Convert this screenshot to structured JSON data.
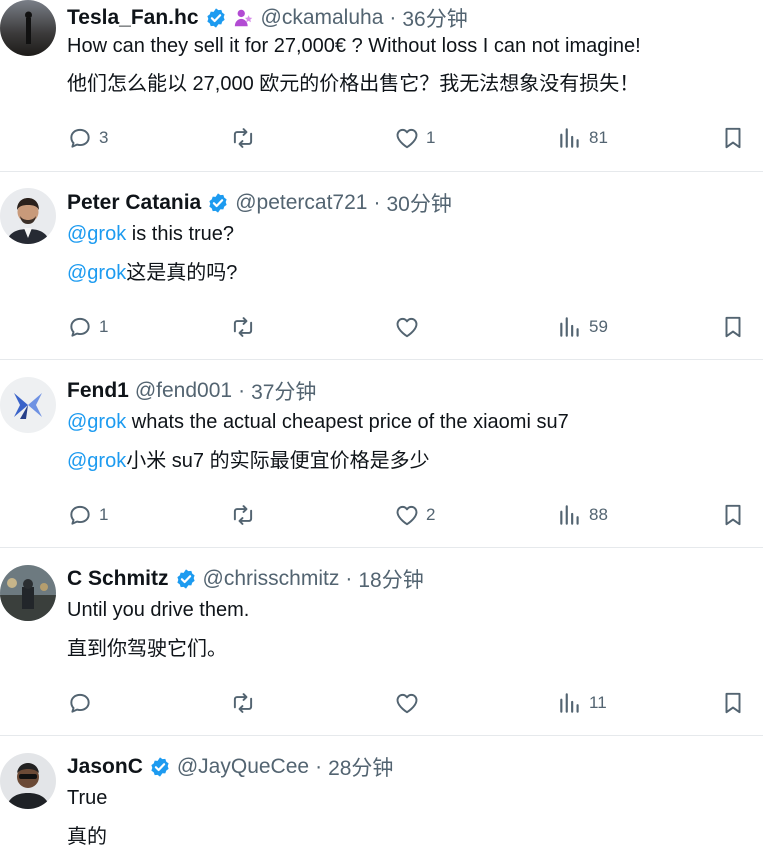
{
  "tweets": [
    {
      "name": "Tesla_Fan.hc",
      "handle": "@ckamaluha",
      "time": "36分钟",
      "text_en": "How can they sell it for 27,000€ ? Without loss I can not imagine!",
      "text_zh": "他们怎么能以 27,000 欧元的价格出售它？我无法想象没有损失！",
      "replies": "3",
      "reposts": "",
      "likes": "1",
      "views": "81"
    },
    {
      "name": "Peter Catania",
      "handle": "@petercat721",
      "time": "30分钟",
      "mention": "@grok",
      "text_en": " is this true?",
      "text_zh": "这是真的吗?",
      "replies": "1",
      "reposts": "",
      "likes": "",
      "views": "59"
    },
    {
      "name": "Fend1",
      "handle": "@fend001",
      "time": "37分钟",
      "mention": "@grok",
      "text_en": " whats the actual cheapest price of the xiaomi su7",
      "text_zh": "小米 su7 的实际最便宜价格是多少",
      "replies": "1",
      "reposts": "",
      "likes": "2",
      "views": "88"
    },
    {
      "name": "C Schmitz",
      "handle": "@chrisschmitz",
      "time": "18分钟",
      "text_en": "Until you drive them.",
      "text_zh": "直到你驾驶它们。",
      "replies": "",
      "reposts": "",
      "likes": "",
      "views": "11"
    },
    {
      "name": "JasonC",
      "handle": "@JayQueCee",
      "time": "28分钟",
      "text_en": "True",
      "text_zh": "真的"
    }
  ],
  "separator": "·",
  "colors": {
    "accent": "#1d9bf0",
    "verified": "#1d9bf0",
    "muted": "#536471",
    "text": "#0f1419",
    "divider": "#e6e9ec"
  }
}
